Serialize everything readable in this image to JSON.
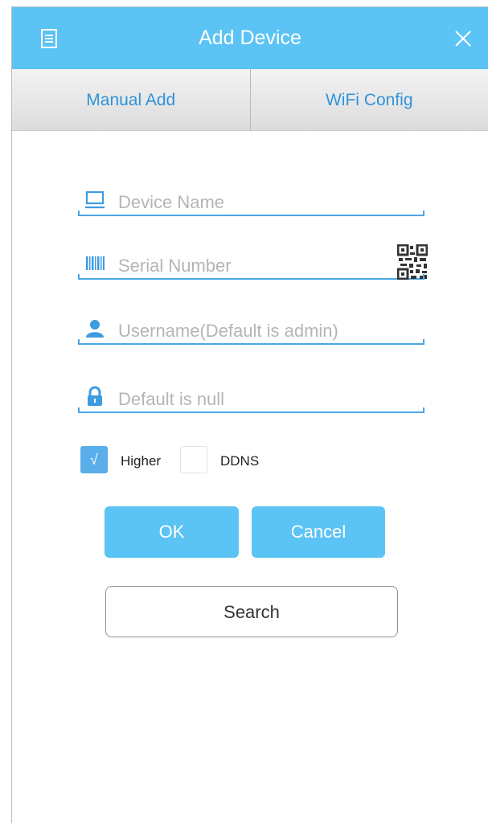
{
  "header": {
    "title": "Add Device",
    "background_color": "#5cc3f5",
    "menu_icon": "document-list-icon",
    "close_icon": "close-icon"
  },
  "tabs": [
    {
      "label": "Manual Add"
    },
    {
      "label": "WiFi Config"
    }
  ],
  "form": {
    "device_name": {
      "placeholder": "Device Name",
      "icon": "monitor-icon"
    },
    "serial_number": {
      "placeholder": "Serial Number",
      "icon": "barcode-icon",
      "scan_icon": "qr-code-icon"
    },
    "username": {
      "placeholder": "Username(Default is admin)",
      "icon": "user-icon"
    },
    "password": {
      "placeholder": "Default is null",
      "icon": "lock-icon"
    }
  },
  "options": {
    "higher": {
      "label": "Higher",
      "checked": true,
      "check_glyph": "√"
    },
    "ddns": {
      "label": "DDNS",
      "checked": false
    }
  },
  "buttons": {
    "ok": "OK",
    "cancel": "Cancel",
    "search": "Search"
  }
}
